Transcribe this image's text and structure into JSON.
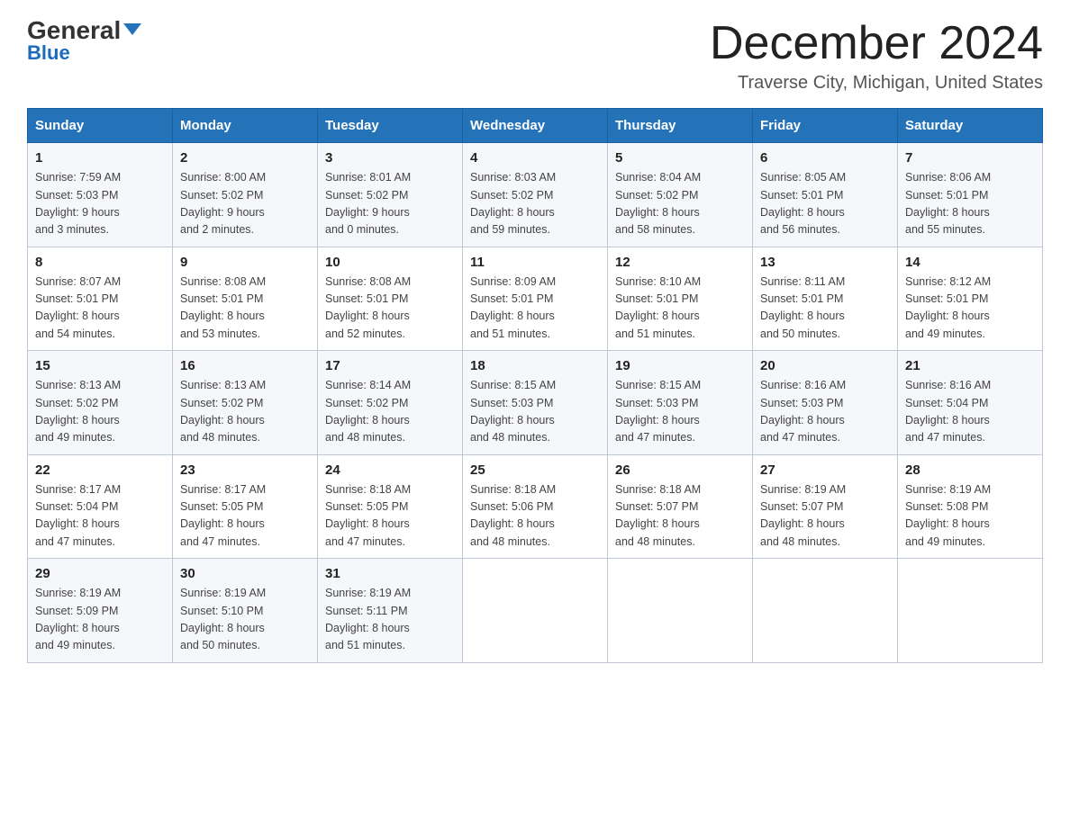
{
  "logo": {
    "general": "General",
    "blue": "Blue"
  },
  "header": {
    "month_title": "December 2024",
    "location": "Traverse City, Michigan, United States"
  },
  "days_of_week": [
    "Sunday",
    "Monday",
    "Tuesday",
    "Wednesday",
    "Thursday",
    "Friday",
    "Saturday"
  ],
  "weeks": [
    [
      {
        "day": "1",
        "sunrise": "7:59 AM",
        "sunset": "5:03 PM",
        "daylight": "9 hours and 3 minutes."
      },
      {
        "day": "2",
        "sunrise": "8:00 AM",
        "sunset": "5:02 PM",
        "daylight": "9 hours and 2 minutes."
      },
      {
        "day": "3",
        "sunrise": "8:01 AM",
        "sunset": "5:02 PM",
        "daylight": "9 hours and 0 minutes."
      },
      {
        "day": "4",
        "sunrise": "8:03 AM",
        "sunset": "5:02 PM",
        "daylight": "8 hours and 59 minutes."
      },
      {
        "day": "5",
        "sunrise": "8:04 AM",
        "sunset": "5:02 PM",
        "daylight": "8 hours and 58 minutes."
      },
      {
        "day": "6",
        "sunrise": "8:05 AM",
        "sunset": "5:01 PM",
        "daylight": "8 hours and 56 minutes."
      },
      {
        "day": "7",
        "sunrise": "8:06 AM",
        "sunset": "5:01 PM",
        "daylight": "8 hours and 55 minutes."
      }
    ],
    [
      {
        "day": "8",
        "sunrise": "8:07 AM",
        "sunset": "5:01 PM",
        "daylight": "8 hours and 54 minutes."
      },
      {
        "day": "9",
        "sunrise": "8:08 AM",
        "sunset": "5:01 PM",
        "daylight": "8 hours and 53 minutes."
      },
      {
        "day": "10",
        "sunrise": "8:08 AM",
        "sunset": "5:01 PM",
        "daylight": "8 hours and 52 minutes."
      },
      {
        "day": "11",
        "sunrise": "8:09 AM",
        "sunset": "5:01 PM",
        "daylight": "8 hours and 51 minutes."
      },
      {
        "day": "12",
        "sunrise": "8:10 AM",
        "sunset": "5:01 PM",
        "daylight": "8 hours and 51 minutes."
      },
      {
        "day": "13",
        "sunrise": "8:11 AM",
        "sunset": "5:01 PM",
        "daylight": "8 hours and 50 minutes."
      },
      {
        "day": "14",
        "sunrise": "8:12 AM",
        "sunset": "5:01 PM",
        "daylight": "8 hours and 49 minutes."
      }
    ],
    [
      {
        "day": "15",
        "sunrise": "8:13 AM",
        "sunset": "5:02 PM",
        "daylight": "8 hours and 49 minutes."
      },
      {
        "day": "16",
        "sunrise": "8:13 AM",
        "sunset": "5:02 PM",
        "daylight": "8 hours and 48 minutes."
      },
      {
        "day": "17",
        "sunrise": "8:14 AM",
        "sunset": "5:02 PM",
        "daylight": "8 hours and 48 minutes."
      },
      {
        "day": "18",
        "sunrise": "8:15 AM",
        "sunset": "5:03 PM",
        "daylight": "8 hours and 48 minutes."
      },
      {
        "day": "19",
        "sunrise": "8:15 AM",
        "sunset": "5:03 PM",
        "daylight": "8 hours and 47 minutes."
      },
      {
        "day": "20",
        "sunrise": "8:16 AM",
        "sunset": "5:03 PM",
        "daylight": "8 hours and 47 minutes."
      },
      {
        "day": "21",
        "sunrise": "8:16 AM",
        "sunset": "5:04 PM",
        "daylight": "8 hours and 47 minutes."
      }
    ],
    [
      {
        "day": "22",
        "sunrise": "8:17 AM",
        "sunset": "5:04 PM",
        "daylight": "8 hours and 47 minutes."
      },
      {
        "day": "23",
        "sunrise": "8:17 AM",
        "sunset": "5:05 PM",
        "daylight": "8 hours and 47 minutes."
      },
      {
        "day": "24",
        "sunrise": "8:18 AM",
        "sunset": "5:05 PM",
        "daylight": "8 hours and 47 minutes."
      },
      {
        "day": "25",
        "sunrise": "8:18 AM",
        "sunset": "5:06 PM",
        "daylight": "8 hours and 48 minutes."
      },
      {
        "day": "26",
        "sunrise": "8:18 AM",
        "sunset": "5:07 PM",
        "daylight": "8 hours and 48 minutes."
      },
      {
        "day": "27",
        "sunrise": "8:19 AM",
        "sunset": "5:07 PM",
        "daylight": "8 hours and 48 minutes."
      },
      {
        "day": "28",
        "sunrise": "8:19 AM",
        "sunset": "5:08 PM",
        "daylight": "8 hours and 49 minutes."
      }
    ],
    [
      {
        "day": "29",
        "sunrise": "8:19 AM",
        "sunset": "5:09 PM",
        "daylight": "8 hours and 49 minutes."
      },
      {
        "day": "30",
        "sunrise": "8:19 AM",
        "sunset": "5:10 PM",
        "daylight": "8 hours and 50 minutes."
      },
      {
        "day": "31",
        "sunrise": "8:19 AM",
        "sunset": "5:11 PM",
        "daylight": "8 hours and 51 minutes."
      },
      null,
      null,
      null,
      null
    ]
  ],
  "labels": {
    "sunrise": "Sunrise:",
    "sunset": "Sunset:",
    "daylight": "Daylight:"
  }
}
